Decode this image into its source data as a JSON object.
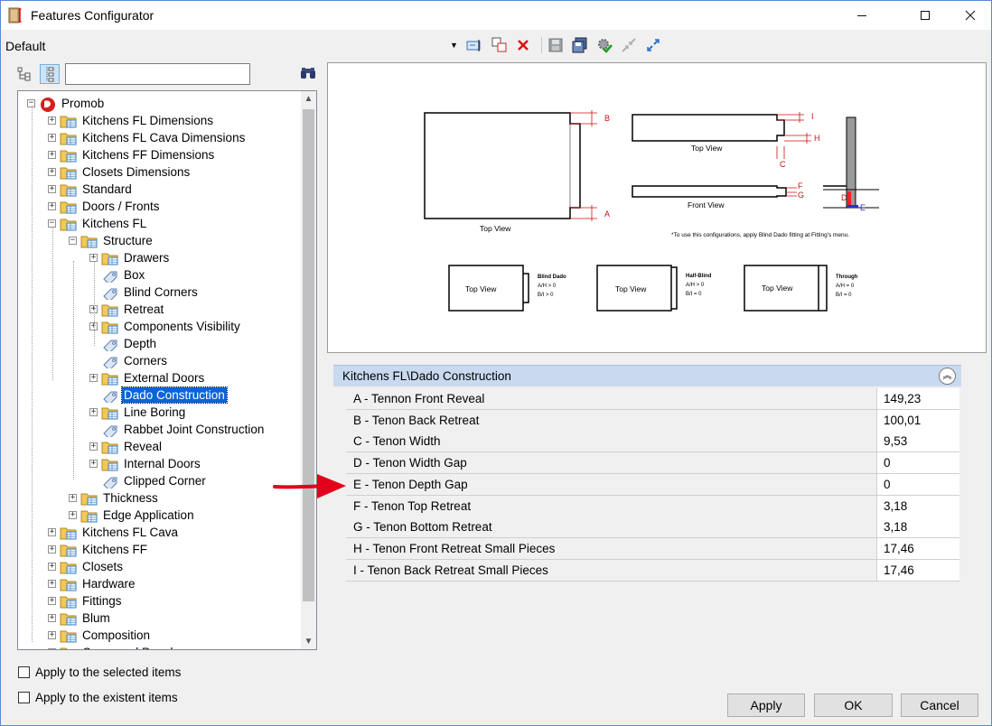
{
  "window": {
    "title": "Features Configurator"
  },
  "toolbar": {
    "profile": "Default"
  },
  "search": {
    "value": ""
  },
  "tree": {
    "nodes": [
      {
        "label": "Promob"
      },
      {
        "label": "Kitchens FL Dimensions"
      },
      {
        "label": "Kitchens FL Cava Dimensions"
      },
      {
        "label": "Kitchens FF Dimensions"
      },
      {
        "label": "Closets Dimensions"
      },
      {
        "label": "Standard"
      },
      {
        "label": "Doors / Fronts"
      },
      {
        "label": "Kitchens FL"
      },
      {
        "label": "Structure"
      },
      {
        "label": "Drawers"
      },
      {
        "label": "Box"
      },
      {
        "label": "Blind Corners"
      },
      {
        "label": "Retreat"
      },
      {
        "label": "Components Visibility"
      },
      {
        "label": "Depth"
      },
      {
        "label": "Corners"
      },
      {
        "label": "External Doors"
      },
      {
        "label": "Dado Construction"
      },
      {
        "label": "Line Boring"
      },
      {
        "label": "Rabbet Joint Construction"
      },
      {
        "label": "Reveal"
      },
      {
        "label": "Internal Doors"
      },
      {
        "label": "Clipped Corner"
      },
      {
        "label": "Thickness"
      },
      {
        "label": "Edge Application"
      },
      {
        "label": "Kitchens FL Cava"
      },
      {
        "label": "Kitchens FF"
      },
      {
        "label": "Closets"
      },
      {
        "label": "Hardware"
      },
      {
        "label": "Fittings"
      },
      {
        "label": "Blum"
      },
      {
        "label": "Composition"
      },
      {
        "label": "Command Panel"
      }
    ]
  },
  "options": {
    "apply_selected": "Apply to the selected items",
    "apply_existent": "Apply to the existent items"
  },
  "diagram": {
    "labels": {
      "top_view": "Top View",
      "front_view": "Front View",
      "note": "*To use this configurations, apply Blind Dado fitting at Fitting's menu.",
      "blind_dado": "Blind Dado",
      "blind_dado_cond1": "A/H > 0",
      "blind_dado_cond2": "B/I  > 0",
      "half_blind": "Half-Blind",
      "half_blind_cond1": "A/H > 0",
      "half_blind_cond2": "B/I  = 0",
      "through": "Through",
      "through_cond1": "A/H = 0",
      "through_cond2": "B/I  = 0",
      "letters": [
        "A",
        "B",
        "C",
        "D",
        "E",
        "F",
        "G",
        "H",
        "I"
      ]
    }
  },
  "group": {
    "title": "Kitchens FL\\Dado Construction"
  },
  "properties": [
    {
      "name": "A - Tennon Front Reveal",
      "value": "149,23"
    },
    {
      "name": "B - Tenon Back Retreat",
      "value": "100,01"
    },
    {
      "name": "C - Tenon Width",
      "value": "9,53"
    },
    {
      "name": "D - Tenon Width Gap",
      "value": "0"
    },
    {
      "name": "E - Tenon Depth Gap",
      "value": "0"
    },
    {
      "name": "F - Tenon Top Retreat",
      "value": "3,18"
    },
    {
      "name": "G - Tenon Bottom Retreat",
      "value": "3,18"
    },
    {
      "name": "H - Tenon Front Retreat Small Pieces",
      "value": "17,46"
    },
    {
      "name": "I - Tenon Back Retreat Small Pieces",
      "value": "17,46"
    }
  ],
  "buttons": {
    "apply": "Apply",
    "ok": "OK",
    "cancel": "Cancel"
  },
  "colors": {
    "accent": "#0a64d8",
    "arrow": "#e3001b",
    "group_header": "#c9d9ef"
  }
}
